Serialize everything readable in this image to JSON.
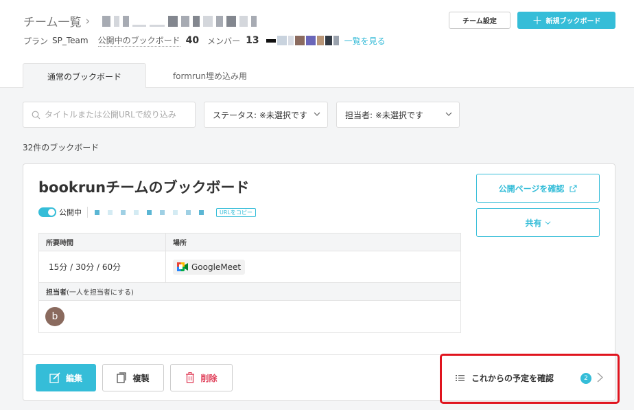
{
  "header": {
    "team_title": "チーム一覧",
    "plan_label": "プラン",
    "plan_name": "SP_Team",
    "public_boards_label": "公開中のブックボード",
    "public_boards_count": "40",
    "members_label": "メンバー",
    "members_count": "13",
    "see_all_label": "一覧を見る",
    "team_settings_label": "チーム設定",
    "new_board_label": "新規ブックボード"
  },
  "tabs": [
    {
      "label": "通常のブックボード",
      "active": true
    },
    {
      "label": "formrun埋め込み用",
      "active": false
    }
  ],
  "filters": {
    "search_placeholder": "タイトルまたは公開URLで絞り込み",
    "status_label": "ステータス: ※未選択です",
    "owner_label": "担当者: ※未選択です"
  },
  "board_count_label": "32件のブックボード",
  "card": {
    "title": "bookrunチームのブックボード",
    "public_status": "公開中",
    "copy_url_label": "URLをコピー",
    "duration_header": "所要時間",
    "duration_value": "15分 / 30分 / 60分",
    "location_header": "場所",
    "location_value": "GoogleMeet",
    "owner_header": "担当者",
    "owner_note": "(一人を担当者にする)",
    "owner_avatar_letter": "b",
    "view_public_page_label": "公開ページを確認",
    "share_label": "共有",
    "edit_label": "編集",
    "duplicate_label": "複製",
    "delete_label": "削除",
    "upcoming_label": "これからの予定を確認",
    "upcoming_count": "2"
  },
  "colors": {
    "accent": "#35bdd8",
    "danger": "#e0405a",
    "highlight": "#e0141e"
  }
}
